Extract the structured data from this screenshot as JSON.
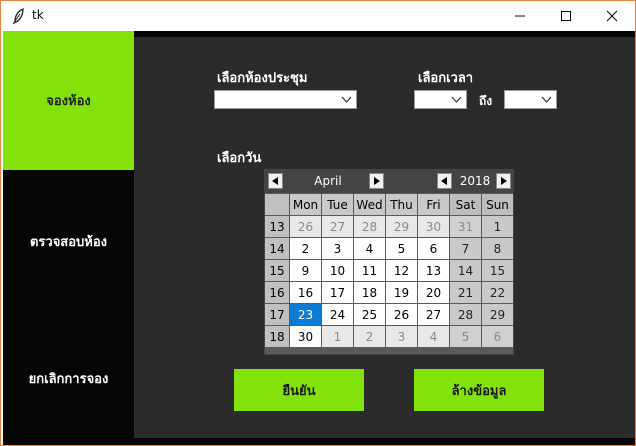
{
  "window": {
    "title": "tk"
  },
  "sidebar": {
    "items": [
      {
        "label": "จองห้อง",
        "active": true
      },
      {
        "label": "ตรวจสอบห้อง",
        "active": false
      },
      {
        "label": "ยกเลิกการจอง",
        "active": false
      }
    ]
  },
  "form": {
    "room_label": "เลือกห้องประชุม",
    "room_value": "",
    "time_label": "เลือกเวลา",
    "time_from_value": "",
    "time_to_label": "ถึง",
    "time_to_value": "",
    "date_label": "เลือกวัน"
  },
  "calendar": {
    "month": "April",
    "year": "2018",
    "weekdays": [
      "Mon",
      "Tue",
      "Wed",
      "Thu",
      "Fri",
      "Sat",
      "Sun"
    ],
    "weeks": [
      {
        "week": "13",
        "days": [
          "26",
          "27",
          "28",
          "29",
          "30",
          "31",
          "1"
        ]
      },
      {
        "week": "14",
        "days": [
          "2",
          "3",
          "4",
          "5",
          "6",
          "7",
          "8"
        ]
      },
      {
        "week": "15",
        "days": [
          "9",
          "10",
          "11",
          "12",
          "13",
          "14",
          "15"
        ]
      },
      {
        "week": "16",
        "days": [
          "16",
          "17",
          "18",
          "19",
          "20",
          "21",
          "22"
        ]
      },
      {
        "week": "17",
        "days": [
          "23",
          "24",
          "25",
          "26",
          "27",
          "28",
          "29"
        ]
      },
      {
        "week": "18",
        "days": [
          "30",
          "1",
          "2",
          "3",
          "4",
          "5",
          "6"
        ]
      }
    ],
    "selected_day": "23",
    "colors": {
      "selected": "#0c7cd5"
    }
  },
  "buttons": {
    "confirm_label": "ยืนยัน",
    "clear_label": "ล้างข้อมูล"
  },
  "colors": {
    "accent": "#84e20b",
    "sidebar_bg": "#050505",
    "main_bg": "#2b2b2b"
  }
}
